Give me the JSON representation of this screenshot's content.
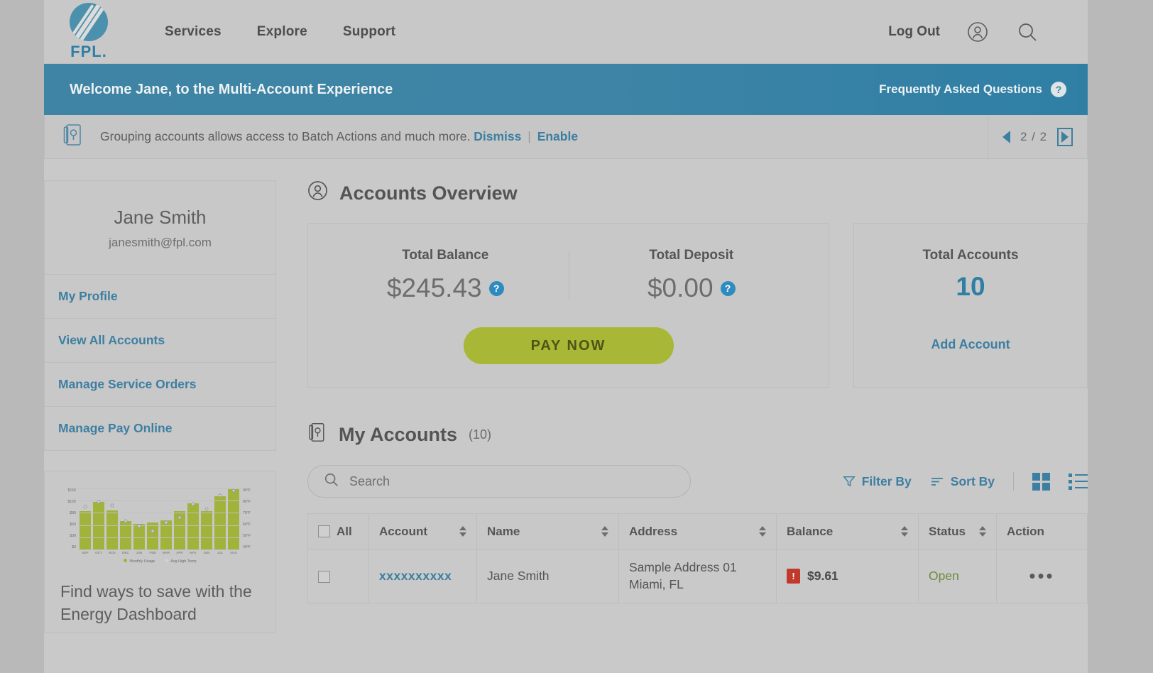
{
  "header": {
    "logo_text": "FPL.",
    "nav": [
      {
        "label": "Services"
      },
      {
        "label": "Explore"
      },
      {
        "label": "Support"
      }
    ],
    "logout_label": "Log Out",
    "account_icon": "user-circle-icon",
    "search_icon": "search-icon"
  },
  "welcome_banner": {
    "title": "Welcome Jane, to the Multi-Account Experience",
    "faq_label": "Frequently Asked Questions",
    "faq_icon": "question-mark-icon"
  },
  "notification": {
    "icon": "account-card-icon",
    "text": "Grouping accounts allows access to Batch Actions and much more.",
    "dismiss_label": "Dismiss",
    "separator": "|",
    "enable_label": "Enable",
    "page_indicator": "2 / 2",
    "prev_icon": "arrow-left-icon",
    "next_icon": "arrow-right-icon"
  },
  "sidebar": {
    "profile": {
      "name": "Jane Smith",
      "email": "janesmith@fpl.com"
    },
    "links": [
      {
        "label": "My Profile"
      },
      {
        "label": "View All Accounts"
      },
      {
        "label": "Manage Service Orders"
      },
      {
        "label": "Manage Pay Online"
      }
    ],
    "promo": {
      "text": "Find ways to save with the Energy Dashboard"
    }
  },
  "chart_data": {
    "type": "bar",
    "title": "",
    "categories": [
      "SEP",
      "OCT",
      "NOV",
      "DEC",
      "JAN",
      "FEB",
      "MAR",
      "APR",
      "MAY",
      "JUN",
      "JUL",
      "AUG"
    ],
    "series": [
      {
        "name": "Monthly Usage",
        "type": "bar",
        "color": "#a2b33c",
        "values": [
          95,
          117,
          96,
          70,
          62,
          66,
          72,
          95,
          113,
          94,
          131,
          149
        ]
      },
      {
        "name": "Avg High Temp",
        "type": "line",
        "color": "#cdd4d8",
        "values": [
          75,
          79,
          76,
          63,
          59,
          55,
          62,
          66,
          77,
          73,
          84,
          88
        ]
      }
    ],
    "ylabel": "",
    "ylabel_right": "",
    "yticks_left": [
      "$150",
      "$120",
      "$90",
      "$60",
      "$30",
      "$0"
    ],
    "yticks_right": [
      "90°F",
      "80°F",
      "70°F",
      "60°F",
      "50°F",
      "40°F"
    ],
    "ylim": [
      0,
      150
    ],
    "ylim_right": [
      40,
      90
    ],
    "legend": [
      "Monthly Usage",
      "Avg High Temp"
    ],
    "legend_position": "bottom",
    "grid": true
  },
  "accounts_overview": {
    "icon": "user-circle-icon",
    "heading": "Accounts Overview",
    "total_balance_label": "Total Balance",
    "total_balance_value": "$245.43",
    "total_deposit_label": "Total Deposit",
    "total_deposit_value": "$0.00",
    "info_icon": "question-mark-icon",
    "pay_now_label": "PAY NOW",
    "total_accounts_label": "Total Accounts",
    "total_accounts_value": "10",
    "add_account_label": "Add Account"
  },
  "my_accounts": {
    "icon": "account-card-icon",
    "heading": "My Accounts",
    "count_label": "(10)",
    "search_placeholder": "Search",
    "search_value": "",
    "search_icon": "search-icon",
    "filter_label": "Filter By",
    "filter_icon": "funnel-icon",
    "sort_label": "Sort By",
    "sort_icon": "sort-lines-icon",
    "grid_view_icon": "grid-view-icon",
    "list_view_icon": "list-view-icon",
    "columns": [
      {
        "label": "All",
        "sortable": false
      },
      {
        "label": "Account",
        "sortable": true
      },
      {
        "label": "Name",
        "sortable": true
      },
      {
        "label": "Address",
        "sortable": true
      },
      {
        "label": "Balance",
        "sortable": true
      },
      {
        "label": "Status",
        "sortable": true
      },
      {
        "label": "Action",
        "sortable": false
      }
    ],
    "rows": [
      {
        "account": "xxxxxxxxxx",
        "name": "Jane Smith",
        "address_line1": "Sample Address 01",
        "address_line2": "Miami, FL",
        "balance": "$9.61",
        "balance_alert": "!",
        "status": "Open",
        "action": "•••"
      }
    ]
  },
  "colors": {
    "brand_blue": "#2f7fa5",
    "link_blue": "#3d7fa1",
    "banner_blue": "#3f84a4",
    "accent_green": "#a8b735",
    "status_open": "#6e8a3c",
    "alert_red": "#c0392b"
  }
}
